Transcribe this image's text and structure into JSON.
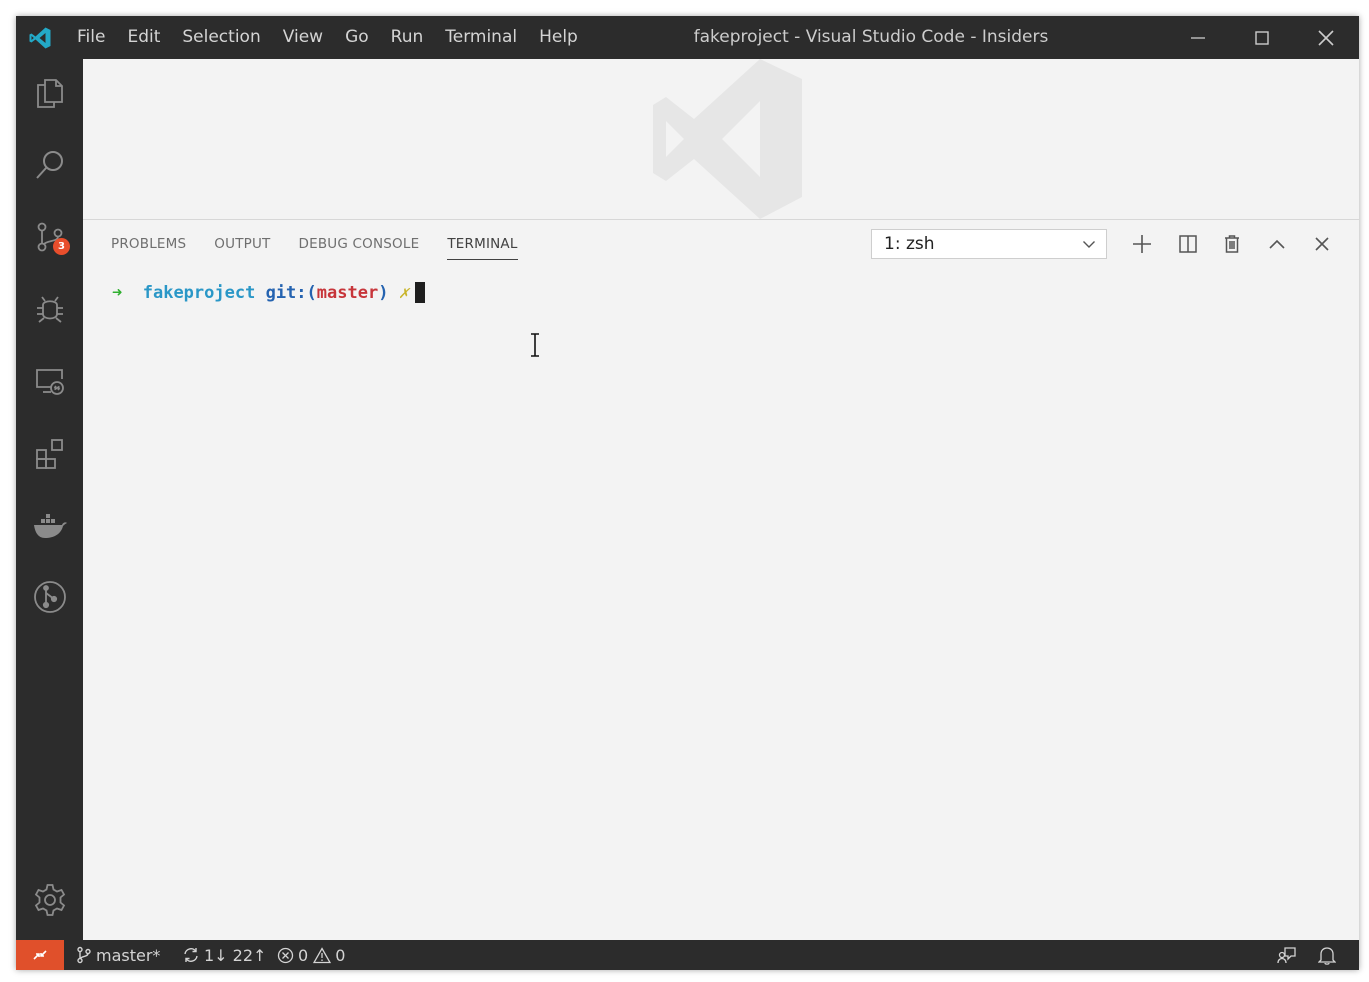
{
  "window": {
    "title": "fakeproject - Visual Studio Code - Insiders"
  },
  "menu": {
    "items": [
      "File",
      "Edit",
      "Selection",
      "View",
      "Go",
      "Run",
      "Terminal",
      "Help"
    ]
  },
  "activity_bar": {
    "items": [
      {
        "name": "explorer",
        "icon": "files-icon"
      },
      {
        "name": "search",
        "icon": "search-icon"
      },
      {
        "name": "source-control",
        "icon": "source-control-icon",
        "badge": "3"
      },
      {
        "name": "run-debug",
        "icon": "debug-icon"
      },
      {
        "name": "remote-explorer",
        "icon": "remote-explorer-icon"
      },
      {
        "name": "extensions",
        "icon": "extensions-icon"
      },
      {
        "name": "docker",
        "icon": "docker-icon"
      },
      {
        "name": "git-graph",
        "icon": "git-graph-icon"
      }
    ],
    "settings_icon": "gear-icon"
  },
  "panel": {
    "tabs": [
      {
        "label": "PROBLEMS",
        "active": false
      },
      {
        "label": "OUTPUT",
        "active": false
      },
      {
        "label": "DEBUG CONSOLE",
        "active": false
      },
      {
        "label": "TERMINAL",
        "active": true
      }
    ],
    "terminal_select": "1: zsh",
    "actions": [
      "plus-icon",
      "split-icon",
      "trash-icon",
      "chevron-up-icon",
      "close-icon"
    ]
  },
  "terminal": {
    "arrow": "➜",
    "directory": "fakeproject",
    "git_prefix": "git:(",
    "branch": "master",
    "git_suffix": ")",
    "dirty_marker": "✗"
  },
  "status_bar": {
    "branch": "master*",
    "sync": "1↓ 22↑",
    "errors": "0",
    "warnings": "0"
  },
  "colors": {
    "title_bar": "#2c2c2c",
    "activity_bar": "#2c2c2c",
    "panel_background": "#f3f3f3",
    "remote_button": "#e0502b",
    "badge": "#e84e2c",
    "logo": "#23a9c7"
  }
}
